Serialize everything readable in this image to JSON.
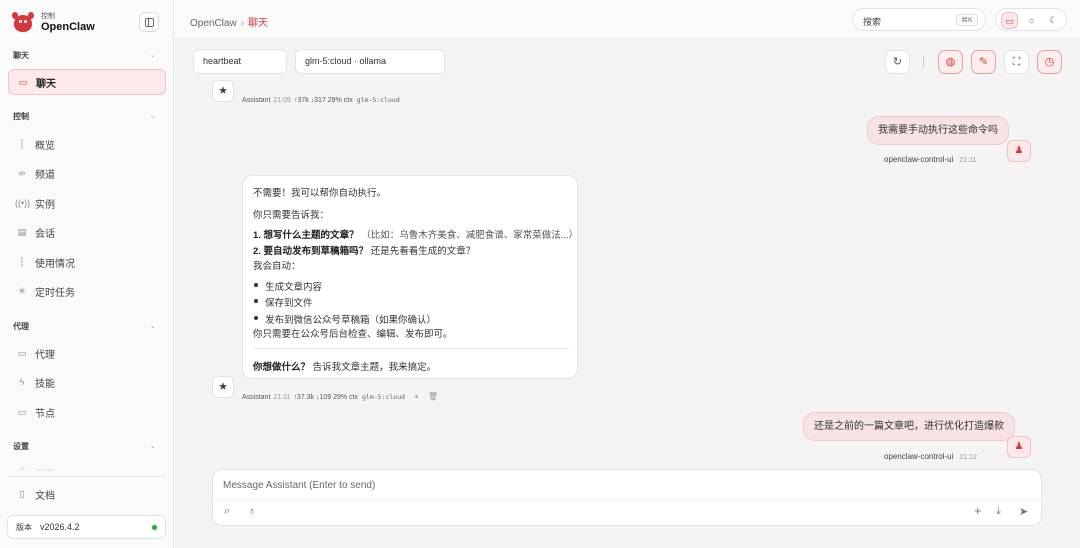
{
  "brand": {
    "sub": "控制",
    "title": "OpenClaw"
  },
  "sidebar": {
    "groups": [
      {
        "title": "聊天"
      },
      {
        "title": "控制"
      },
      {
        "title": "代理"
      },
      {
        "title": "设置"
      }
    ],
    "items": [
      {
        "label": "聊天",
        "icon": "chat-icon"
      },
      {
        "label": "概览",
        "icon": "bar-chart-icon"
      },
      {
        "label": "频道",
        "icon": "link-icon"
      },
      {
        "label": "实例",
        "icon": "radio-icon"
      },
      {
        "label": "会话",
        "icon": "document-icon"
      },
      {
        "label": "使用情况",
        "icon": "bar-chart-icon"
      },
      {
        "label": "定时任务",
        "icon": "loader-icon"
      },
      {
        "label": "代理",
        "icon": "folder-icon"
      },
      {
        "label": "技能",
        "icon": "lightning-icon"
      },
      {
        "label": "节点",
        "icon": "monitor-icon"
      },
      {
        "label": "配置",
        "icon": "gear-icon"
      },
      {
        "label": "文档",
        "icon": "book-icon"
      }
    ],
    "version_label": "版本",
    "version_value": "v2026.4.2"
  },
  "topbar": {
    "breadcrumb_root": "OpenClaw",
    "breadcrumb_sep": "›",
    "breadcrumb_current": "聊天",
    "search_placeholder": "搜索",
    "search_shortcut": "⌘K"
  },
  "chat": {
    "session_chip": "heartbeat",
    "model_chip": "glm-5:cloud · ollama",
    "msg1_meta": {
      "role": "Assistant",
      "time": "21:09",
      "stats": "↑37k  ↓317  29% ctx",
      "model": "glm-5:cloud"
    },
    "msg2": {
      "text": "我需要手动执行这些命令吗",
      "sender": "openclaw-control-ui",
      "time": "21:11"
    },
    "msg3": {
      "line1": "不需要！我可以帮你自动执行。",
      "line2": "你只需要告诉我：",
      "item1_bold": "1. 想写什么主题的文章？",
      "item1_rest": "（比如：乌鲁木齐美食、减肥食谱、家常菜做法...）",
      "item2_bold": "2. 要自动发布到草稿箱吗？",
      "item2_rest": "还是先看看生成的文章？",
      "line3": "我会自动：",
      "bullets": [
        "生成文章内容",
        "保存到文件",
        "发布到微信公众号草稿箱（如果你确认）"
      ],
      "line4": "你只需要在公众号后台检查、编辑、发布即可。",
      "closing_bold": "你想做什么？",
      "closing_rest": "告诉我文章主题，我来搞定。"
    },
    "msg3_meta": {
      "role": "Assistant",
      "time": "21:11",
      "stats": "↑37.3k  ↓109  29% ctx",
      "model": "glm-5:cloud"
    },
    "msg4": {
      "text": "还是之前的一篇文章吧，进行优化打造爆款",
      "sender": "openclaw-control-ui",
      "time": "21:12"
    }
  },
  "composer": {
    "placeholder": "Message Assistant (Enter to send)"
  }
}
